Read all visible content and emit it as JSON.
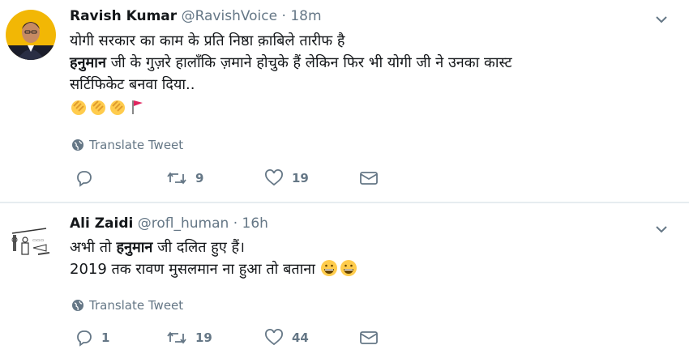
{
  "tweets": [
    {
      "name": "Ravish Kumar",
      "handle": "@RavishVoice",
      "separator": "·",
      "time": "18m",
      "lines": {
        "l1": "योगी सरकार का काम के प्रति निष्ठा क़ाबिले तारीफ है",
        "l2_bold": "हनुमान",
        "l2_rest": " जी के गुज़रे हालाँकि ज़माने होचुके हैं लेकिन फिर भी योगी जी ने उनका कास्ट",
        "l3": "सर्टिफिकेट बनवा दिया.."
      },
      "emojis": [
        "clapping-hands",
        "clapping-hands",
        "clapping-hands",
        "red-flag"
      ],
      "translate_label": "Translate Tweet",
      "stats": {
        "replies": "",
        "retweets": "9",
        "likes": "19"
      }
    },
    {
      "name": "Ali Zaidi",
      "handle": "@rofl_human",
      "separator": "·",
      "time": "16h",
      "lines": {
        "l1_pre": "अभी तो ",
        "l1_bold": "हनुमान",
        "l1_post": " जी दलित हुए हैं।",
        "l2": "2019 तक रावण मुसलमान ना हुआ तो बताना"
      },
      "emojis": [
        "grinning-face",
        "grinning-face"
      ],
      "translate_label": "Translate Tweet",
      "stats": {
        "replies": "1",
        "retweets": "19",
        "likes": "44"
      }
    }
  ],
  "colors": {
    "text": "#14171a",
    "muted": "#657786",
    "divider": "#e6ecf0",
    "accent": "#1da1f2",
    "flag": "#e0245e",
    "emoji": "#ffcc4d"
  }
}
